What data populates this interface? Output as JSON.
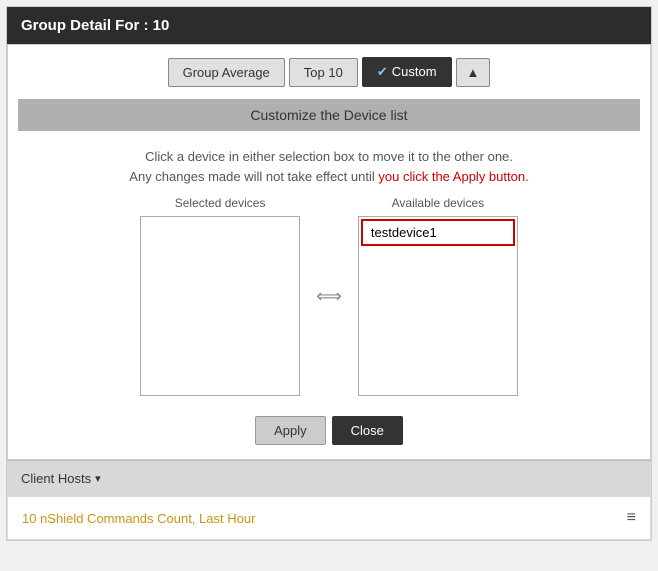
{
  "header": {
    "title": "Group Detail For : 10"
  },
  "toolbar": {
    "group_average_label": "Group Average",
    "top10_label": "Top 10",
    "custom_label": "Custom",
    "custom_active": true,
    "chevron_icon": "▲"
  },
  "section": {
    "title": "Customize the Device list"
  },
  "info": {
    "line1": "Click a device in either selection box to move it to the other one.",
    "line2_before": "Any changes made will not take effect until ",
    "line2_highlight": "you click the Apply button.",
    "line2_after": ""
  },
  "selected_devices": {
    "label": "Selected devices",
    "items": []
  },
  "available_devices": {
    "label": "Available devices",
    "items": [
      {
        "name": "testdevice1"
      }
    ]
  },
  "buttons": {
    "apply_label": "Apply",
    "close_label": "Close"
  },
  "client_hosts": {
    "label": "Client Hosts",
    "dropdown_arrow": "▾"
  },
  "chart": {
    "title": "10 nShield Commands Count, Last Hour",
    "menu_icon": "≡"
  }
}
